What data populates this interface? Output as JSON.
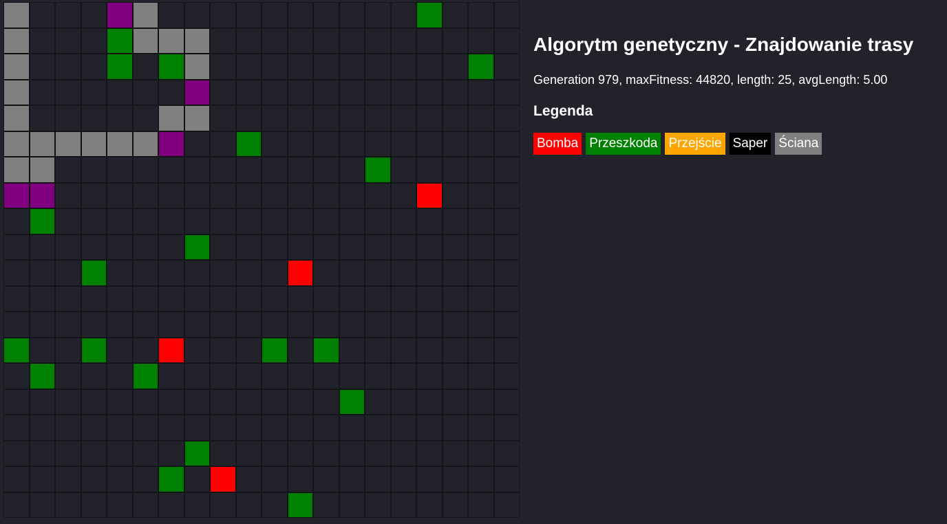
{
  "header": {
    "title": "Algorytm genetyczny - Znajdowanie trasy",
    "status": "Generation 979, maxFitness: 44820, length: 25, avgLength: 5.00"
  },
  "legend": {
    "title": "Legenda",
    "items": [
      {
        "key": "bomb",
        "label": "Bomba",
        "color": "#ff0000"
      },
      {
        "key": "obstacle",
        "label": "Przeszkoda",
        "color": "#008000"
      },
      {
        "key": "passage",
        "label": "Przejście",
        "color": "#ffa500"
      },
      {
        "key": "saper",
        "label": "Saper",
        "color": "#000000"
      },
      {
        "key": "wall",
        "label": "Ściana",
        "color": "#808080"
      }
    ]
  },
  "board": {
    "rows": 20,
    "cols": 20,
    "path_color": "#800080",
    "legend_map": {
      ".": "empty",
      "B": "bomb",
      "G": "obstacle",
      "W": "wall",
      "P": "path"
    },
    "grid": [
      "W...PW..........G...",
      "W...GWWW............",
      "W...G.GW..........G.",
      "W......P............",
      "W.....WW............",
      "WWWWWWP..G..........",
      "WW............G.....",
      "PP..............B...",
      ".G..................",
      ".......G............",
      "...G.......B........",
      "....................",
      "....................",
      "G..G..B...G.G.......",
      ".G...G..............",
      ".............G......",
      "....................",
      ".......G............",
      "......G.B...........",
      "...........G........"
    ]
  }
}
